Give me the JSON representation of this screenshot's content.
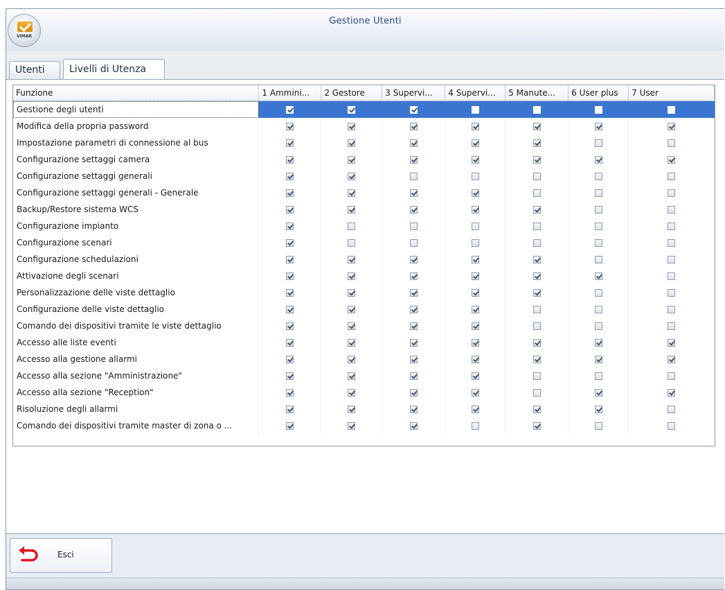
{
  "window": {
    "title": "Gestione Utenti",
    "logo_text": "VIMAR"
  },
  "tabs": [
    {
      "label": "Utenti",
      "active": false
    },
    {
      "label": "Livelli di Utenza",
      "active": true
    }
  ],
  "grid": {
    "columns": [
      "Funzione",
      "1 Ammini...",
      "2 Gestore",
      "3 Supervi...",
      "4 Supervi...",
      "5 Manute...",
      "6 User plus",
      "7 User"
    ],
    "selected_row": 0,
    "rows": [
      {
        "funzione": "Gestione degli utenti",
        "levels": [
          true,
          true,
          true,
          false,
          false,
          false,
          false
        ]
      },
      {
        "funzione": "Modifica della propria password",
        "levels": [
          true,
          true,
          true,
          true,
          true,
          true,
          true
        ]
      },
      {
        "funzione": "Impostazione parametri di connessione al bus",
        "levels": [
          true,
          true,
          true,
          true,
          true,
          false,
          false
        ]
      },
      {
        "funzione": "Configurazione settaggi camera",
        "levels": [
          true,
          true,
          true,
          true,
          true,
          true,
          true
        ]
      },
      {
        "funzione": "Configurazione settaggi generali",
        "levels": [
          true,
          true,
          false,
          false,
          false,
          false,
          false
        ]
      },
      {
        "funzione": "Configurazione settaggi generali - Generale",
        "levels": [
          true,
          true,
          true,
          true,
          false,
          false,
          false
        ]
      },
      {
        "funzione": "Backup/Restore sistema WCS",
        "levels": [
          true,
          true,
          true,
          true,
          true,
          false,
          false
        ]
      },
      {
        "funzione": "Configurazione impianto",
        "levels": [
          true,
          false,
          false,
          false,
          false,
          false,
          false
        ]
      },
      {
        "funzione": "Configurazione scenari",
        "levels": [
          true,
          false,
          false,
          false,
          false,
          false,
          false
        ]
      },
      {
        "funzione": "Configurazione schedulazioni",
        "levels": [
          true,
          true,
          true,
          true,
          true,
          false,
          false
        ]
      },
      {
        "funzione": "Attivazione degli scenari",
        "levels": [
          true,
          true,
          true,
          true,
          true,
          true,
          false
        ]
      },
      {
        "funzione": "Personalizzazione delle viste dettaglio",
        "levels": [
          true,
          true,
          true,
          true,
          true,
          false,
          false
        ]
      },
      {
        "funzione": "Configurazione delle viste dettaglio",
        "levels": [
          true,
          true,
          true,
          true,
          false,
          false,
          false
        ]
      },
      {
        "funzione": "Comando dei dispositivi tramite le viste dettaglio",
        "levels": [
          true,
          true,
          true,
          true,
          false,
          false,
          false
        ]
      },
      {
        "funzione": "Accesso alle liste eventi",
        "levels": [
          true,
          true,
          true,
          true,
          true,
          true,
          true
        ]
      },
      {
        "funzione": "Accesso alla gestione allarmi",
        "levels": [
          true,
          true,
          true,
          true,
          true,
          true,
          true
        ]
      },
      {
        "funzione": "Accesso alla sezione \"Amministrazione\"",
        "levels": [
          true,
          true,
          true,
          true,
          false,
          false,
          false
        ]
      },
      {
        "funzione": "Accesso alla sezione \"Reception\"",
        "levels": [
          true,
          true,
          true,
          true,
          false,
          true,
          true
        ]
      },
      {
        "funzione": "Risoluzione degli allarmi",
        "levels": [
          true,
          true,
          true,
          true,
          true,
          true,
          false
        ]
      },
      {
        "funzione": "Comando dei dispositivi tramite master di zona o ...",
        "levels": [
          true,
          true,
          true,
          false,
          true,
          false,
          false
        ]
      }
    ]
  },
  "footer": {
    "exit_label": "Esci",
    "exit_icon": "undo-arrow-icon",
    "exit_icon_color": "#e0141e"
  }
}
